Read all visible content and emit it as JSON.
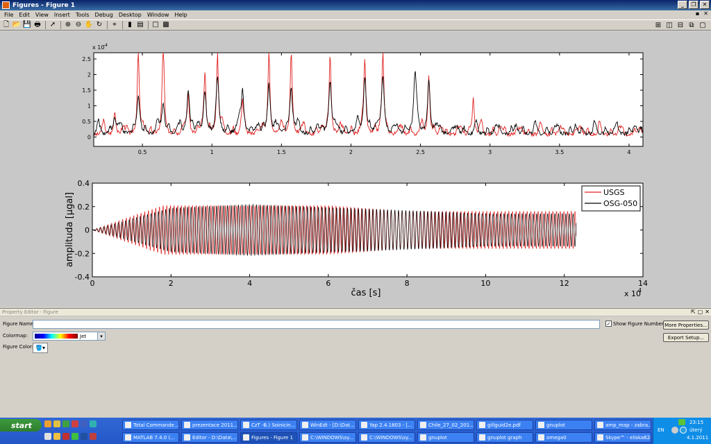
{
  "window": {
    "title": "Figures - Figure 1"
  },
  "menu": {
    "items": [
      "File",
      "Edit",
      "View",
      "Insert",
      "Tools",
      "Debug",
      "Desktop",
      "Window",
      "Help"
    ]
  },
  "icons": {
    "toolbar": [
      "new-icon",
      "open-icon",
      "save-icon",
      "print-icon",
      "pointer-icon",
      "zoom-in-icon",
      "zoom-out-icon",
      "pan-icon",
      "rotate-icon",
      "data-cursor-icon",
      "colorbar-icon",
      "legend-icon",
      "hide-plot-tools-icon",
      "show-plot-tools-icon"
    ]
  },
  "chart_data": [
    {
      "type": "line",
      "x_ticks": [
        "0.5",
        "1",
        "1.5",
        "2",
        "2.5",
        "3",
        "3.5",
        "4"
      ],
      "y_ticks": [
        "0",
        "0.5",
        "1",
        "1.5",
        "2",
        "2.5"
      ],
      "y_exponent": "x 10",
      "y_exponent_power": "-4",
      "xlim": [
        0.15,
        4.1
      ],
      "ylim": [
        -0.3,
        2.7
      ],
      "series": [
        {
          "color": "#e02020",
          "peaks": [
            [
              0.3,
              0.6
            ],
            [
              0.47,
              2.6
            ],
            [
              0.65,
              2.6
            ],
            [
              0.83,
              1.3
            ],
            [
              0.95,
              1.9
            ],
            [
              1.04,
              2.6
            ],
            [
              1.22,
              0.9
            ],
            [
              1.41,
              2.6
            ],
            [
              1.57,
              2.6
            ],
            [
              1.85,
              2.6
            ],
            [
              2.1,
              2.3
            ],
            [
              2.23,
              2.5
            ],
            [
              2.56,
              1.9
            ],
            [
              2.88,
              1.2
            ]
          ]
        },
        {
          "color": "#000000",
          "peaks": [
            [
              0.3,
              0.5
            ],
            [
              0.47,
              1.0
            ],
            [
              0.65,
              1.0
            ],
            [
              0.83,
              1.4
            ],
            [
              0.95,
              1.2
            ],
            [
              1.04,
              1.5
            ],
            [
              1.22,
              1.4
            ],
            [
              1.41,
              1.6
            ],
            [
              1.57,
              1.5
            ],
            [
              1.85,
              1.7
            ],
            [
              2.1,
              1.8
            ],
            [
              2.23,
              1.8
            ],
            [
              2.46,
              1.8
            ],
            [
              2.56,
              1.5
            ]
          ]
        }
      ]
    },
    {
      "type": "line",
      "x_ticks": [
        "0",
        "2",
        "4",
        "6",
        "8",
        "10",
        "12",
        "14"
      ],
      "y_ticks": [
        "-0.4",
        "-0.2",
        "0",
        "0.2",
        "0.4"
      ],
      "xlabel": "čas [s]",
      "ylabel": "amplituda [μgal]",
      "x_exponent": "x 10",
      "x_exponent_power": "4",
      "xlim": [
        0,
        14
      ],
      "ylim": [
        -0.4,
        0.4
      ],
      "legend": "top-right",
      "series": [
        {
          "name": "USGS",
          "color": "#e02020",
          "end": 12.3,
          "amplitude": [
            [
              0,
              0
            ],
            [
              1.8,
              0.21
            ],
            [
              6,
              0.21
            ],
            [
              8,
              0.16
            ],
            [
              12.3,
              0.16
            ]
          ]
        },
        {
          "name": "OSG-050",
          "color": "#000000",
          "end": 12.3,
          "amplitude": [
            [
              0,
              0
            ],
            [
              2,
              0.19
            ],
            [
              4,
              0.22
            ],
            [
              7,
              0.18
            ],
            [
              10,
              0.14
            ],
            [
              12.3,
              0.14
            ]
          ]
        }
      ]
    }
  ],
  "property_editor": {
    "title": "Property Editor - Figure",
    "figure_name_label": "Figure Name:",
    "figure_name_value": "",
    "colormap_label": "Colormap:",
    "colormap_value": "Jet",
    "figure_color_label": "Figure Color:",
    "show_figure_number": "Show Figure Number",
    "more_properties": "More Properties...",
    "export_setup": "Export Setup..."
  },
  "taskbar": {
    "start": "start",
    "row1": [
      {
        "label": "Total Commande..."
      },
      {
        "label": "prezentace 2011..."
      },
      {
        "label": "CzT -B.) Soinicin..."
      },
      {
        "label": "WinEdt - [D:\\Dat..."
      },
      {
        "label": "Yap 2.4.1803 - [..."
      },
      {
        "label": "Chile_27_02_201..."
      },
      {
        "label": "gillguid2e.pdf"
      },
      {
        "label": "gnuplot"
      },
      {
        "label": "amp_map - zabra..."
      }
    ],
    "row2": [
      {
        "label": "MATLAB 7.4.0 (..."
      },
      {
        "label": "Editor - D:\\Data\\..."
      },
      {
        "label": "Figures - Figure 1"
      },
      {
        "label": "C:\\WINDOWS\\sy..."
      },
      {
        "label": "C:\\WINDOWS\\sy..."
      },
      {
        "label": "gnuplot"
      },
      {
        "label": "gnuplot graph"
      },
      {
        "label": "omega0"
      },
      {
        "label": "Skype™ - eliska628"
      }
    ],
    "lang": "EN",
    "time": "23:15",
    "day": "úterý",
    "date": "4.1.2011"
  }
}
